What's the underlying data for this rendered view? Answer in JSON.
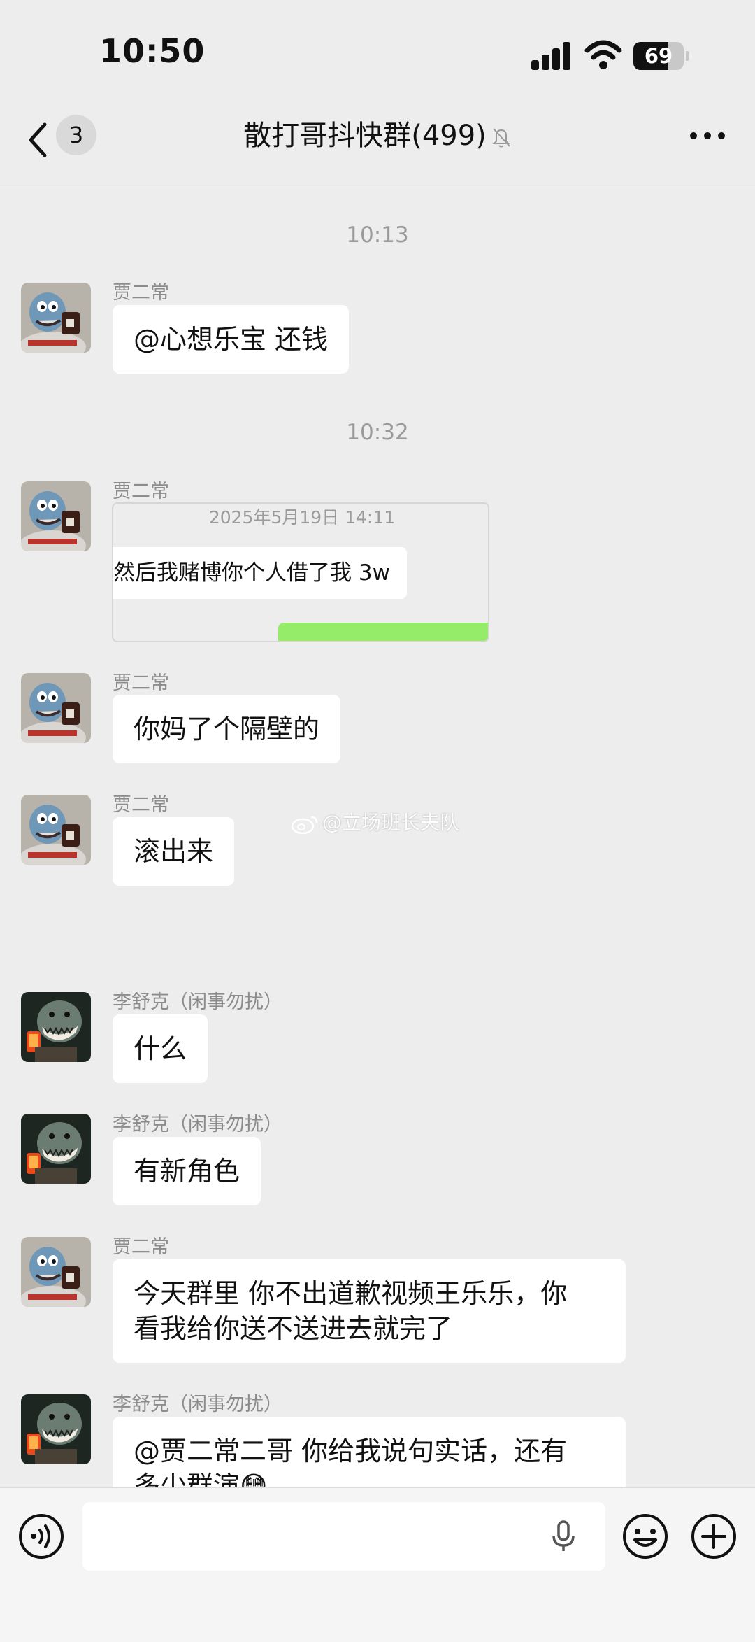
{
  "status": {
    "time": "10:50",
    "battery": "69",
    "battery_level": 0.69
  },
  "header": {
    "unread_count": "3",
    "title": "散打哥抖快群(499)"
  },
  "messages": {
    "t1": "10:13",
    "m1": {
      "sender": "贾二常",
      "text": "@心想乐宝 还钱"
    },
    "t2": "10:32",
    "m2": {
      "sender": "贾二常",
      "quote_date": "2025年5月19日 14:11",
      "quote_text": "然后我赌博你个人借了我 3w"
    },
    "m3": {
      "sender": "贾二常",
      "text": "你妈了个隔壁的"
    },
    "m4": {
      "sender": "贾二常",
      "text": "滚出来"
    },
    "m5": {
      "sender": "李舒克（闲事勿扰）",
      "text": "什么"
    },
    "m6": {
      "sender": "李舒克（闲事勿扰）",
      "text": "有新角色"
    },
    "m7": {
      "sender": "贾二常",
      "line1": "今天群里 你不出道歉视频王乐乐，你",
      "line2": "看我给你送不送进去就完了"
    },
    "m8": {
      "sender": "李舒克（闲事勿扰）",
      "line1": "@贾二常二哥 你给我说句实话，还有",
      "line2": "多少群演😳"
    }
  },
  "watermark": "@立场班长夫队",
  "colors": {
    "background": "#ededed",
    "bubble": "#ffffff",
    "self_bubble": "#95ec69",
    "muted_text": "#8c8c8c"
  },
  "icons": [
    "back-icon",
    "mute-bell-icon",
    "more-icon",
    "voice-icon",
    "mic-icon",
    "emoji-icon",
    "plus-icon"
  ]
}
